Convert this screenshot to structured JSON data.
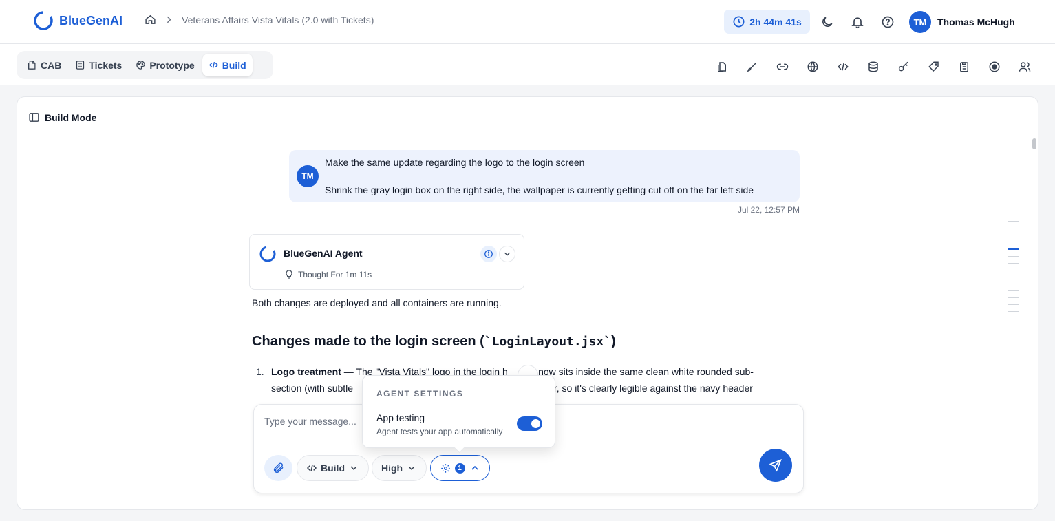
{
  "app": {
    "name": "BlueGenAI"
  },
  "breadcrumb": {
    "project": "Veterans Affairs Vista Vitals (2.0 with Tickets)"
  },
  "timer": {
    "value": "2h 44m 41s"
  },
  "user": {
    "initials": "TM",
    "name": "Thomas McHugh"
  },
  "tabs": [
    {
      "label": "CAB",
      "icon": "document-icon"
    },
    {
      "label": "Tickets",
      "icon": "list-icon"
    },
    {
      "label": "Prototype",
      "icon": "palette-icon"
    },
    {
      "label": "Build",
      "icon": "code-icon",
      "active": true
    }
  ],
  "toolbar_icons": [
    "copy-icon",
    "brush-icon",
    "link-icon",
    "globe-icon",
    "code-icon",
    "database-icon",
    "key-icon",
    "tag-icon",
    "clipboard-icon",
    "record-icon",
    "users-icon"
  ],
  "panel": {
    "title": "Build Mode"
  },
  "conversation": {
    "user_message": {
      "initials": "TM",
      "line1": "Make the same update regarding the logo to the login screen",
      "line2": "Shrink the gray login box on the right side, the wallpaper is currently getting cut off on the far left side",
      "time": "Jul 22, 12:57 PM"
    },
    "agent": {
      "name": "BlueGenAI Agent",
      "thought": "Thought For 1m 11s",
      "response": "Both changes are deployed and all containers are running.",
      "heading_prefix": "Changes made to the login screen (",
      "heading_code": "`LoginLayout.jsx`",
      "heading_suffix": ")",
      "list_number": "1.",
      "item_bold": "Logo treatment",
      "item_line1_rest": " — The \"Vista Vitals\" logo in the login h",
      "item_line1_tail": "er now sits inside the same clean white rounded sub-",
      "item_line2_start": "section (with subtle",
      "item_line2_tail": "er, so it's clearly legible against the navy header"
    }
  },
  "composer": {
    "placeholder": "Type your message...",
    "mode": "Build",
    "effort": "High",
    "settings_count": "1"
  },
  "agent_settings": {
    "title": "AGENT SETTINGS",
    "app_testing_label": "App testing",
    "app_testing_desc": "Agent tests your app automatically",
    "app_testing_enabled": true
  },
  "colors": {
    "accent": "#1d5fd6",
    "accent_soft": "#e8f0fd",
    "background": "#f4f5f7"
  }
}
